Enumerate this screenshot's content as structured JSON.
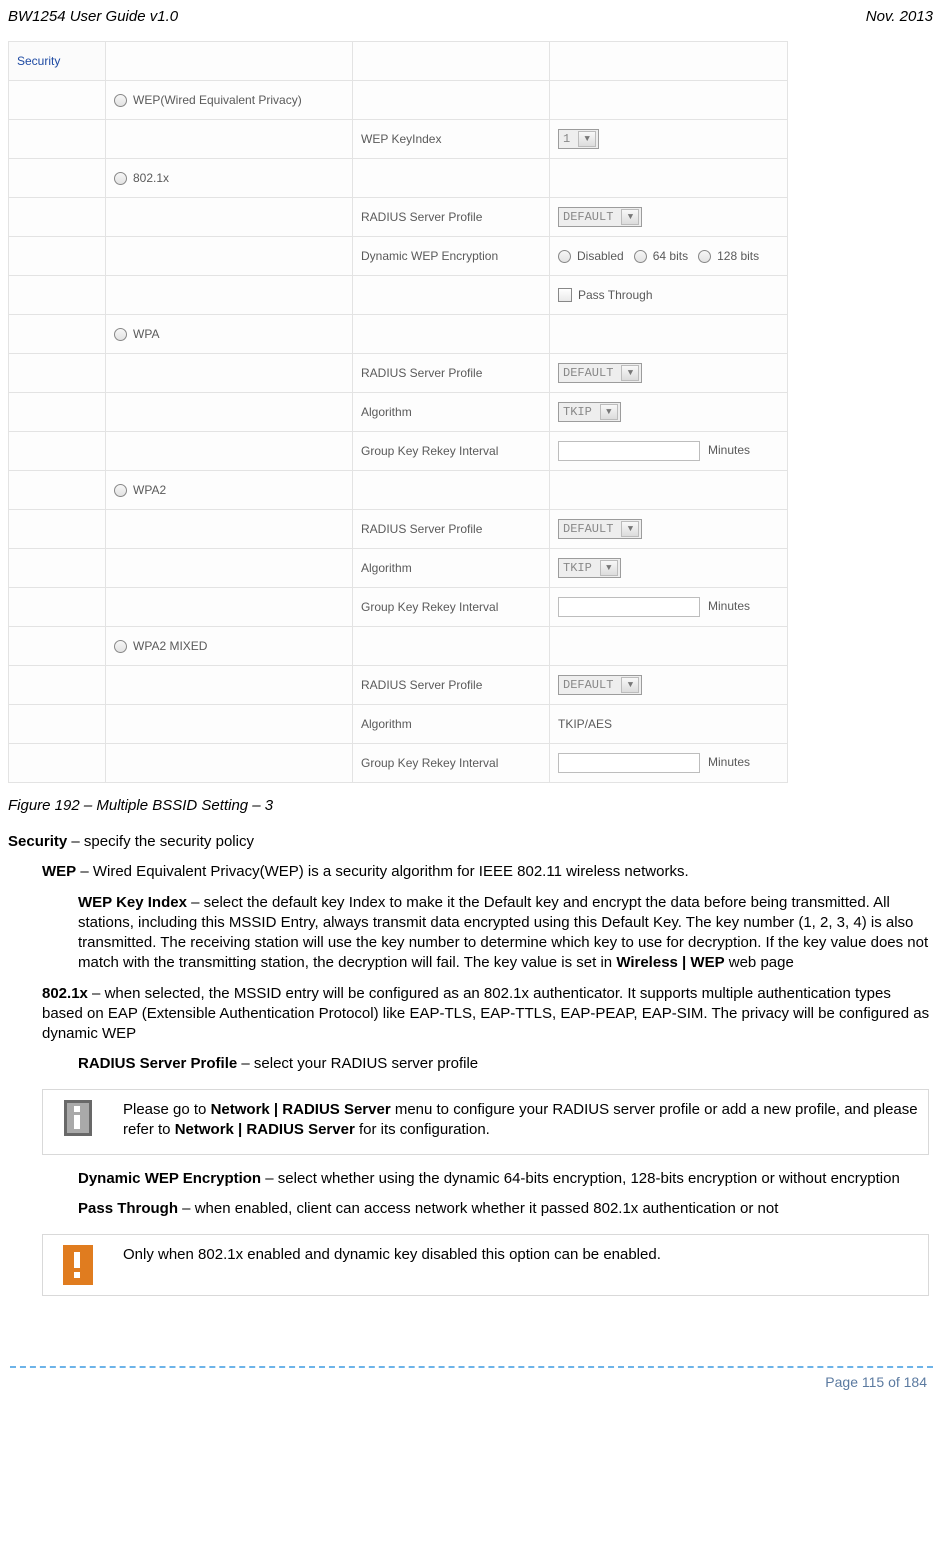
{
  "header": {
    "left": "BW1254 User Guide v1.0",
    "right": "Nov.  2013"
  },
  "shot": {
    "security_label": "Security",
    "wep_label": "WEP(Wired Equivalent Privacy)",
    "wep_keyindex_label": "WEP KeyIndex",
    "wep_keyindex_value": "1",
    "x8021_label": "802.1x",
    "radius_label": "RADIUS Server Profile",
    "radius_value": "DEFAULT",
    "dynwep_label": "Dynamic WEP Encryption",
    "dynwep_opts": {
      "disabled": "Disabled",
      "b64": "64 bits",
      "b128": "128 bits"
    },
    "passthrough_label": "Pass Through",
    "wpa_label": "WPA",
    "algorithm_label": "Algorithm",
    "tkip_value": "TKIP",
    "gkri_label": "Group Key Rekey Interval",
    "minutes": "Minutes",
    "wpa2_label": "WPA2",
    "wpa2mixed_label": "WPA2 MIXED",
    "tkipaes_value": "TKIP/AES"
  },
  "caption": "Figure 192 – Multiple BSSID Setting – 3",
  "body": {
    "security_line_a": "Security",
    "security_line_b": " – specify the security policy",
    "wep_line_a": "WEP",
    "wep_line_b": " – Wired Equivalent Privacy(WEP) is a security algorithm for IEEE 802.11 wireless networks.",
    "wepkey_a": "WEP Key Index",
    "wepkey_b": " – select the default key Index to make it the Default key and encrypt the data before being transmitted. All stations, including this MSSID Entry, always transmit data encrypted using this Default Key. The key number (1, 2, 3, 4) is also transmitted. The receiving station will use the key number to determine which key to use for decryption. If the key value does not match with the transmitting station, the decryption will fail. The key value is set in ",
    "wepkey_c": "Wireless | WEP",
    "wepkey_d": " web page",
    "x8021_a": "802.1x",
    "x8021_b": " – when selected, the MSSID entry will be configured as an 802.1x authenticator. It supports multiple authentication types based on EAP (Extensible Authentication Protocol) like EAP-TLS, EAP-TTLS, EAP-PEAP, EAP-SIM. The privacy will be configured as dynamic WEP",
    "radius_a": "RADIUS Server Profile",
    "radius_b": " – select your RADIUS server profile",
    "info_a": "Please go to ",
    "info_b": "Network | RADIUS Server",
    "info_c": " menu to configure your RADIUS server profile or add a new profile, and please refer to ",
    "info_d": "Network | RADIUS Server",
    "info_e": " for its configuration.",
    "dyn_a": "Dynamic WEP Encryption",
    "dyn_b": " – select whether using the dynamic 64-bits encryption, 128-bits encryption or without encryption",
    "pass_a": "Pass Through",
    "pass_b": " – when enabled, client can access network whether it passed 802.1x authentication or not",
    "warn": "Only when 802.1x enabled and dynamic key disabled this option can be enabled."
  },
  "footer": "Page 115 of 184"
}
